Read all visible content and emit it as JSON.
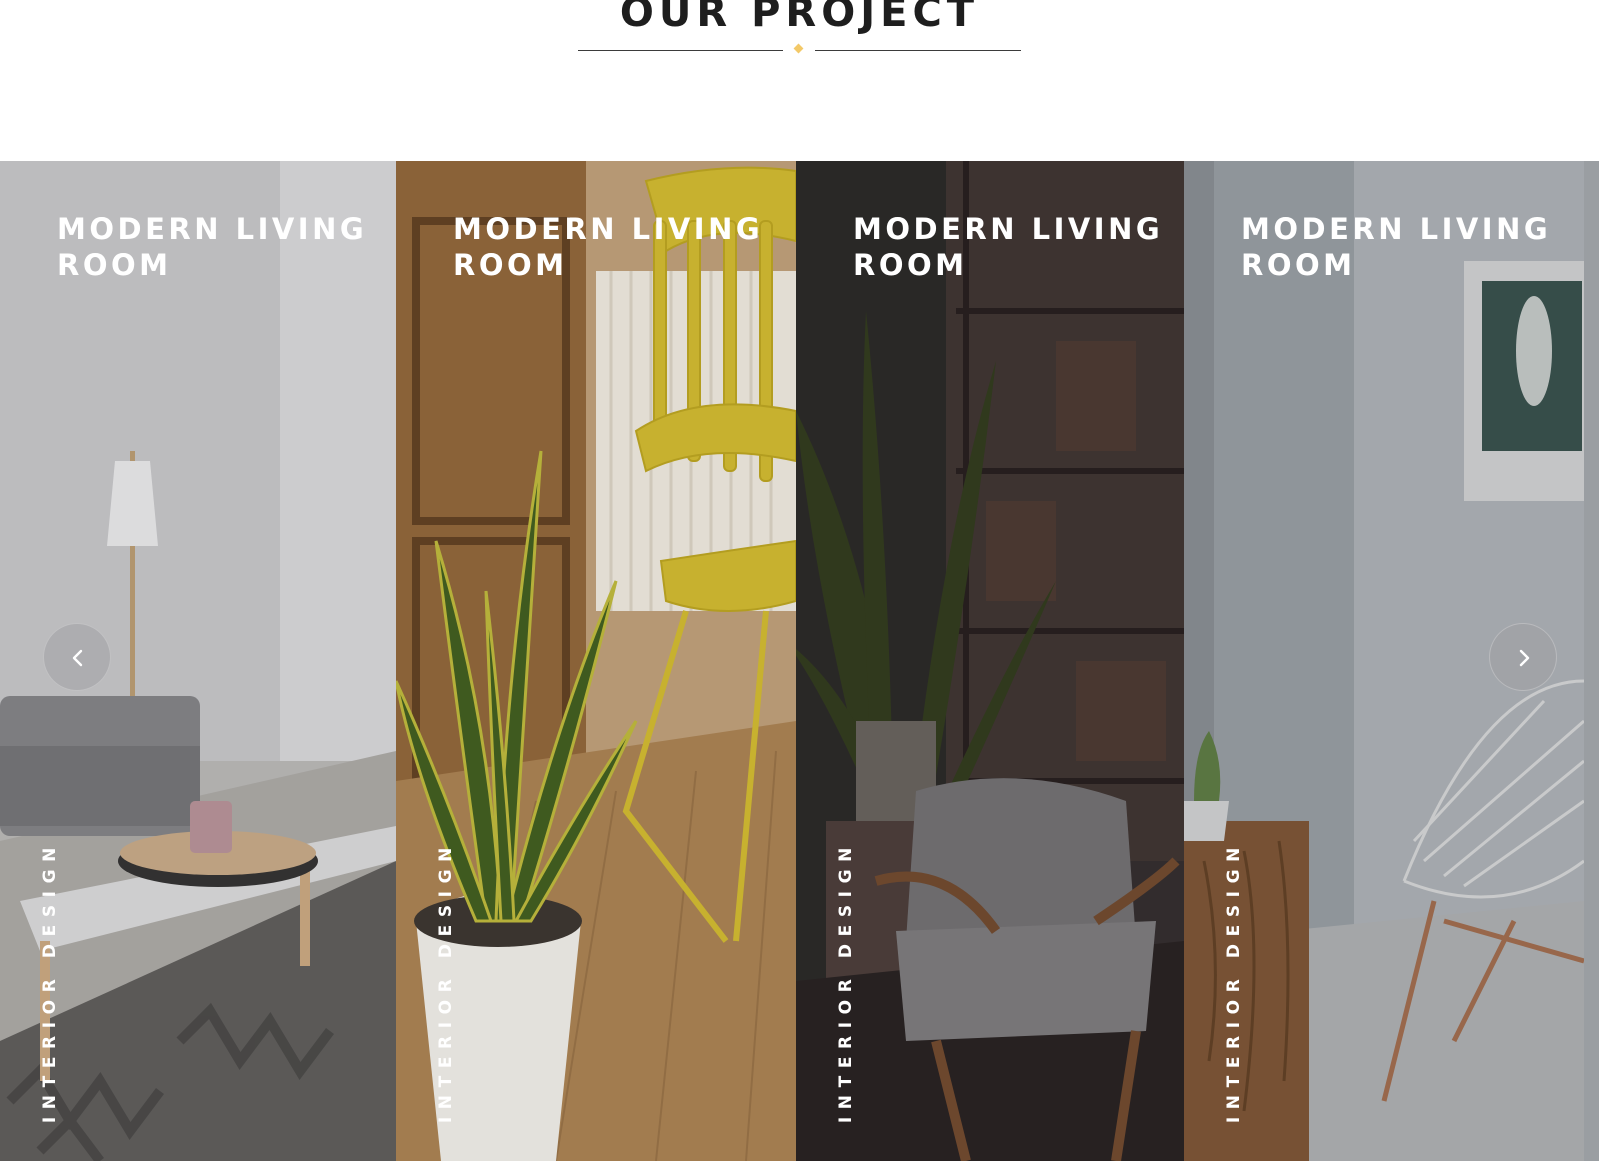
{
  "section": {
    "title": "OUR PROJECT",
    "accent_color": "#f3c968"
  },
  "projects": [
    {
      "title": "MODERN LIVING ROOM",
      "category": "INTERIOR DESIGN"
    },
    {
      "title": "MODERN LIVING ROOM",
      "category": "INTERIOR DESIGN"
    },
    {
      "title": "MODERN LIVING ROOM",
      "category": "INTERIOR DESIGN"
    },
    {
      "title": "MODERN LIVING ROOM",
      "category": "INTERIOR DESIGN"
    }
  ],
  "navigation": {
    "prev_icon": "chevron-left-icon",
    "next_icon": "chevron-right-icon"
  }
}
